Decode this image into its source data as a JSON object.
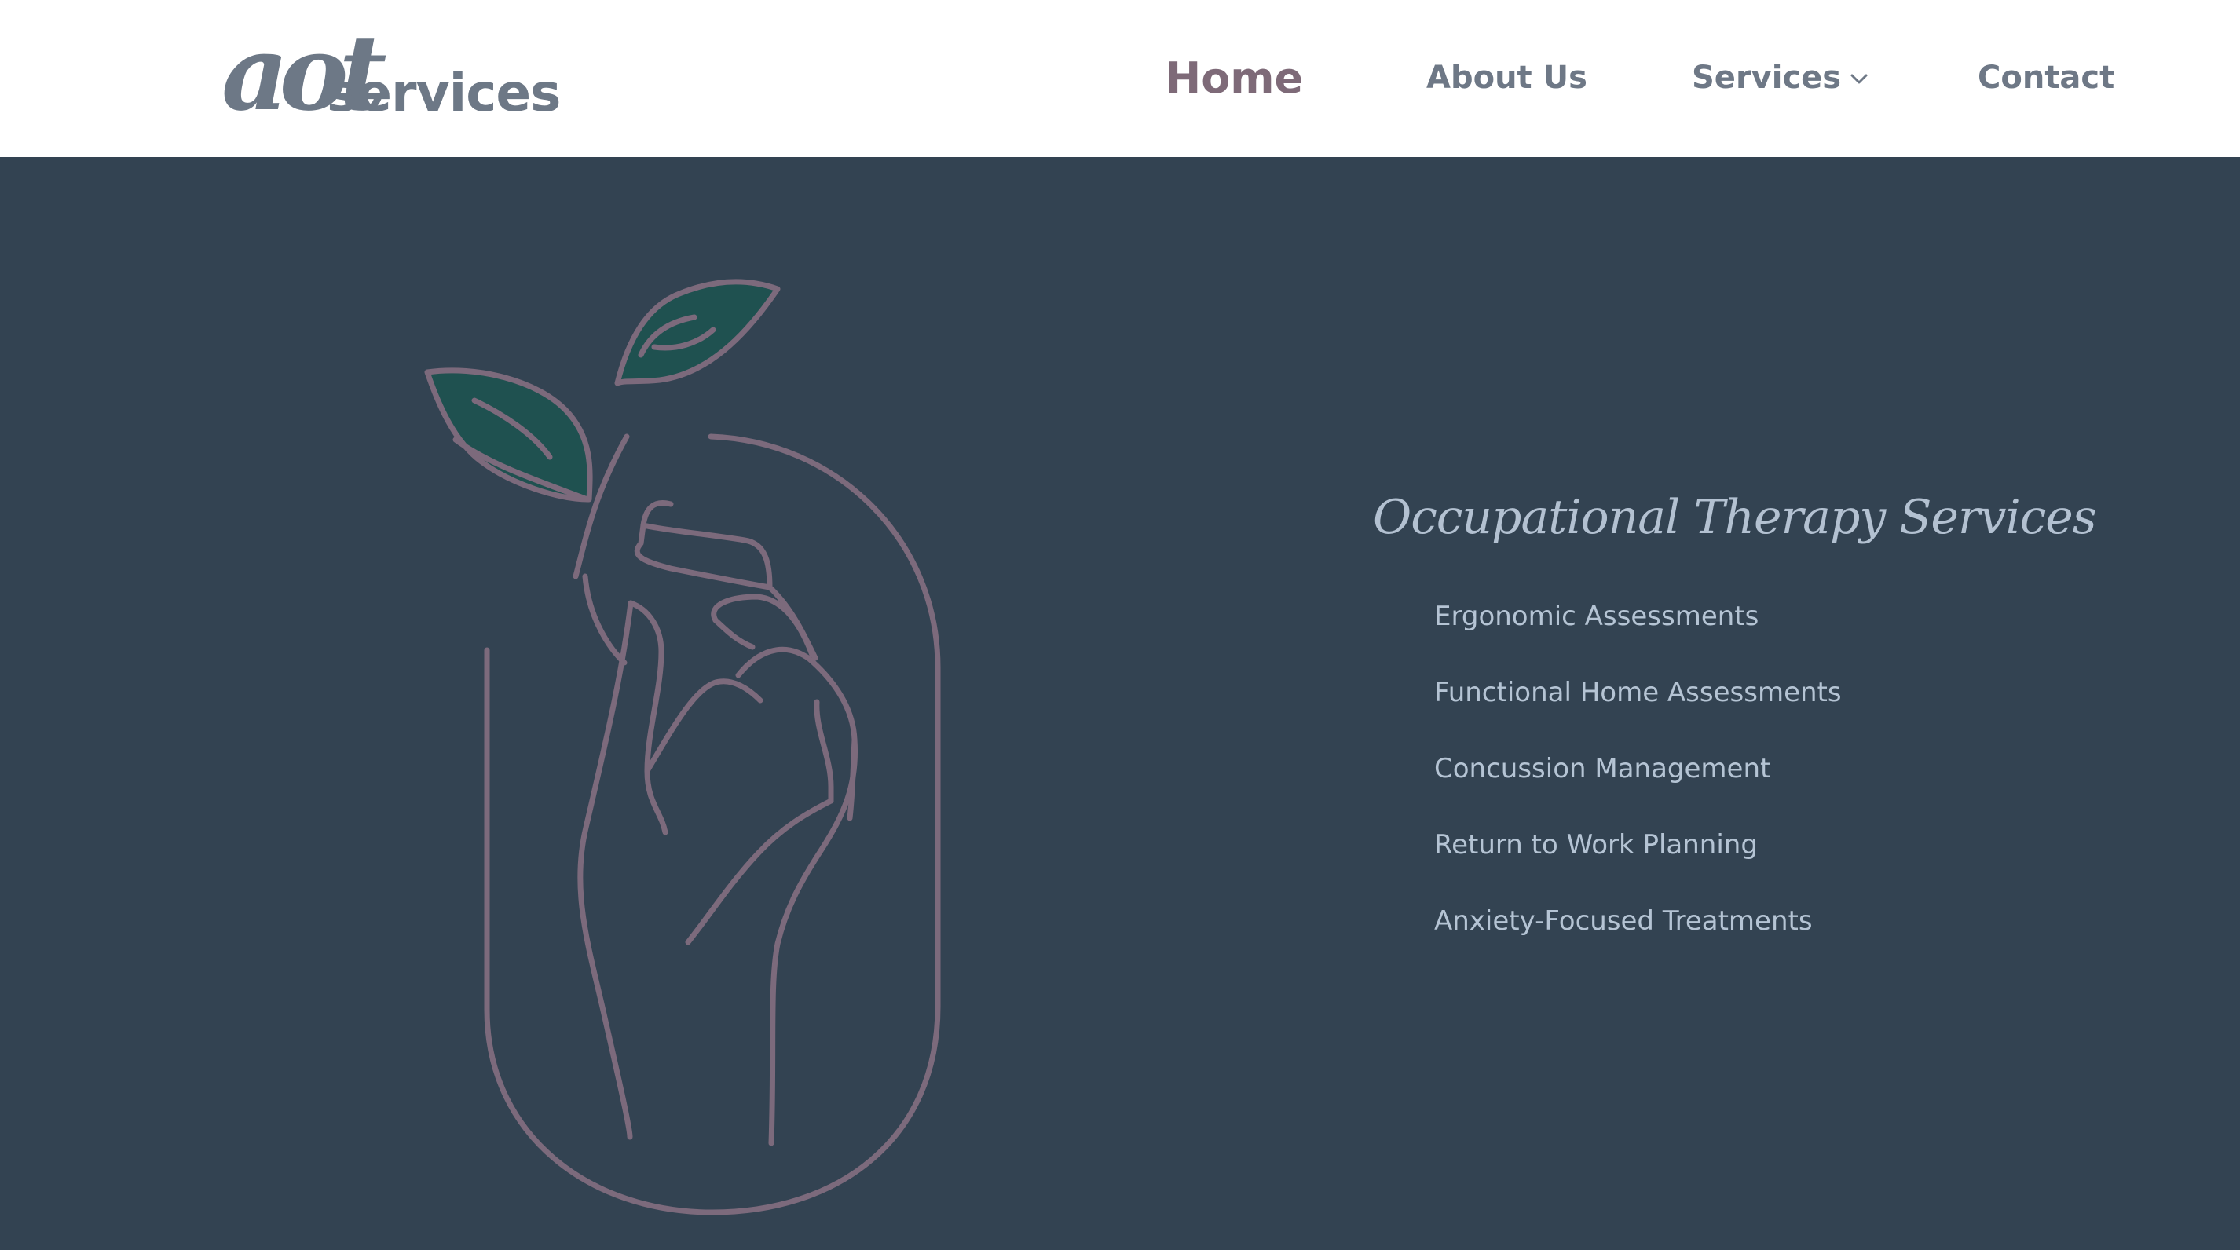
{
  "header": {
    "logo": {
      "script_text": "aot",
      "word_text": "services"
    },
    "nav": {
      "home": "Home",
      "about": "About Us",
      "services": "Services",
      "contact": "Contact"
    },
    "icons": {
      "services_dropdown": "chevron-down-icon"
    }
  },
  "hero": {
    "illustration": "hand-holding-sprout-illustration",
    "title": "Occupational Therapy Services",
    "services": [
      "Ergonomic Assessments",
      "Functional Home Assessments",
      "Concussion Management",
      "Return to Work Planning",
      "Anxiety-Focused Treatments"
    ]
  },
  "colors": {
    "hero_background": "#334352",
    "nav_text": "#6e7886",
    "nav_active": "#7e6a78",
    "illustration_line": "#7c6a7c",
    "leaf_fill": "#1f5150",
    "services_text": "#b5c4d4"
  }
}
